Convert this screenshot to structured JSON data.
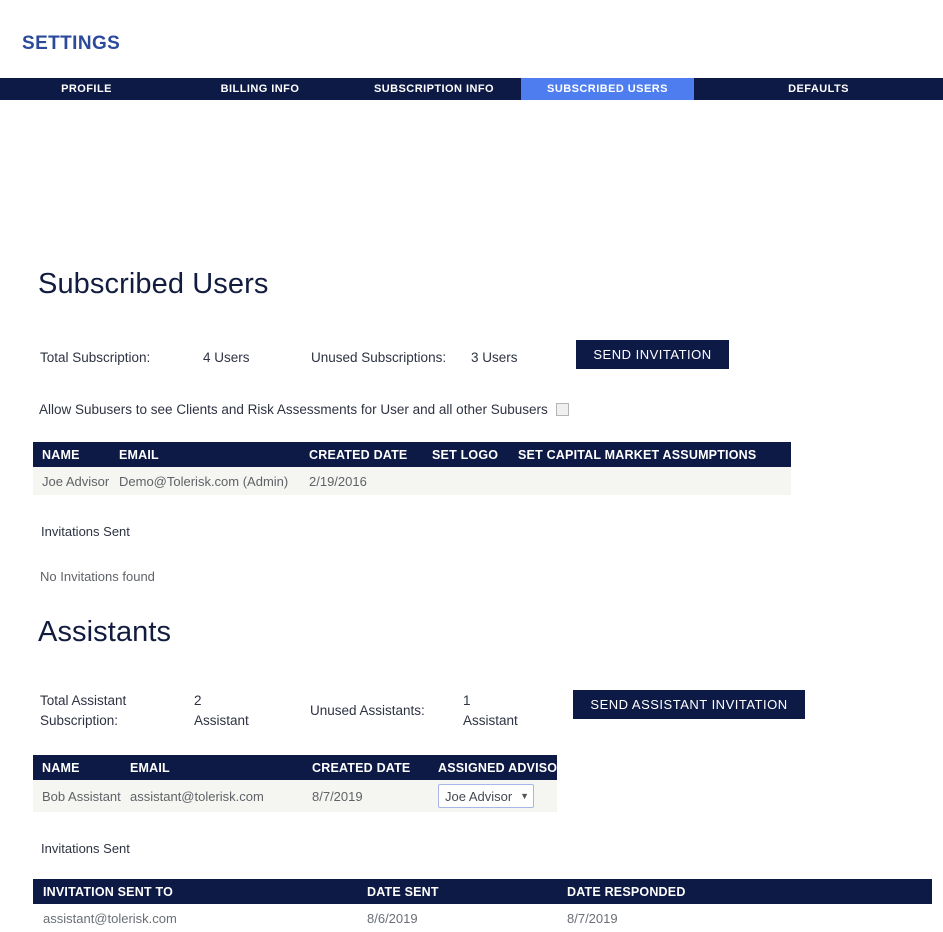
{
  "header": {
    "title": "SETTINGS"
  },
  "tabs": [
    {
      "label": "PROFILE",
      "active": false
    },
    {
      "label": "BILLING INFO",
      "active": false
    },
    {
      "label": "SUBSCRIPTION INFO",
      "active": false
    },
    {
      "label": "SUBSCRIBED USERS",
      "active": true
    },
    {
      "label": "DEFAULTS",
      "active": false
    }
  ],
  "subscribed_users": {
    "heading": "Subscribed Users",
    "total_label": "Total Subscription:",
    "total_value": "4 Users",
    "unused_label": "Unused Subscriptions:",
    "unused_value": "3 Users",
    "send_invitation_button": "SEND INVITATION",
    "allow_subusers_text": "Allow Subusers to see Clients and Risk Assessments for User and all other Subusers",
    "allow_subusers_checked": false,
    "columns": [
      "NAME",
      "EMAIL",
      "CREATED DATE",
      "SET LOGO",
      "SET CAPITAL MARKET ASSUMPTIONS"
    ],
    "rows": [
      {
        "name": "Joe Advisor",
        "email": "Demo@Tolerisk.com (Admin)",
        "created_date": "2/19/2016",
        "set_logo": "",
        "set_capital_market_assumptions": ""
      }
    ],
    "invitations_sent_label": "Invitations Sent",
    "no_invitations_text": "No Invitations found"
  },
  "assistants": {
    "heading": "Assistants",
    "total_label": "Total Assistant\nSubscription:",
    "total_value": "2\nAssistant",
    "unused_label": "Unused Assistants:",
    "unused_value": "1\nAssistant",
    "send_invitation_button": "SEND ASSISTANT INVITATION",
    "columns": [
      "NAME",
      "EMAIL",
      "CREATED DATE",
      "ASSIGNED ADVISOR"
    ],
    "rows": [
      {
        "name": "Bob Assistant",
        "email": "assistant@tolerisk.com",
        "created_date": "8/7/2019",
        "assigned_advisor": "Joe Advisor"
      }
    ],
    "invitations_sent_label": "Invitations Sent"
  },
  "invitations": {
    "columns": [
      "INVITATION SENT TO",
      "DATE SENT",
      "DATE RESPONDED"
    ],
    "rows": [
      {
        "sent_to": "assistant@tolerisk.com",
        "date_sent": "8/6/2019",
        "date_responded": "8/7/2019"
      }
    ]
  },
  "colors": {
    "navy": "#0d1a45",
    "active_tab_blue": "#4e7df0",
    "title_blue": "#2b4a9b",
    "row_shade": "#f5f5f1"
  }
}
